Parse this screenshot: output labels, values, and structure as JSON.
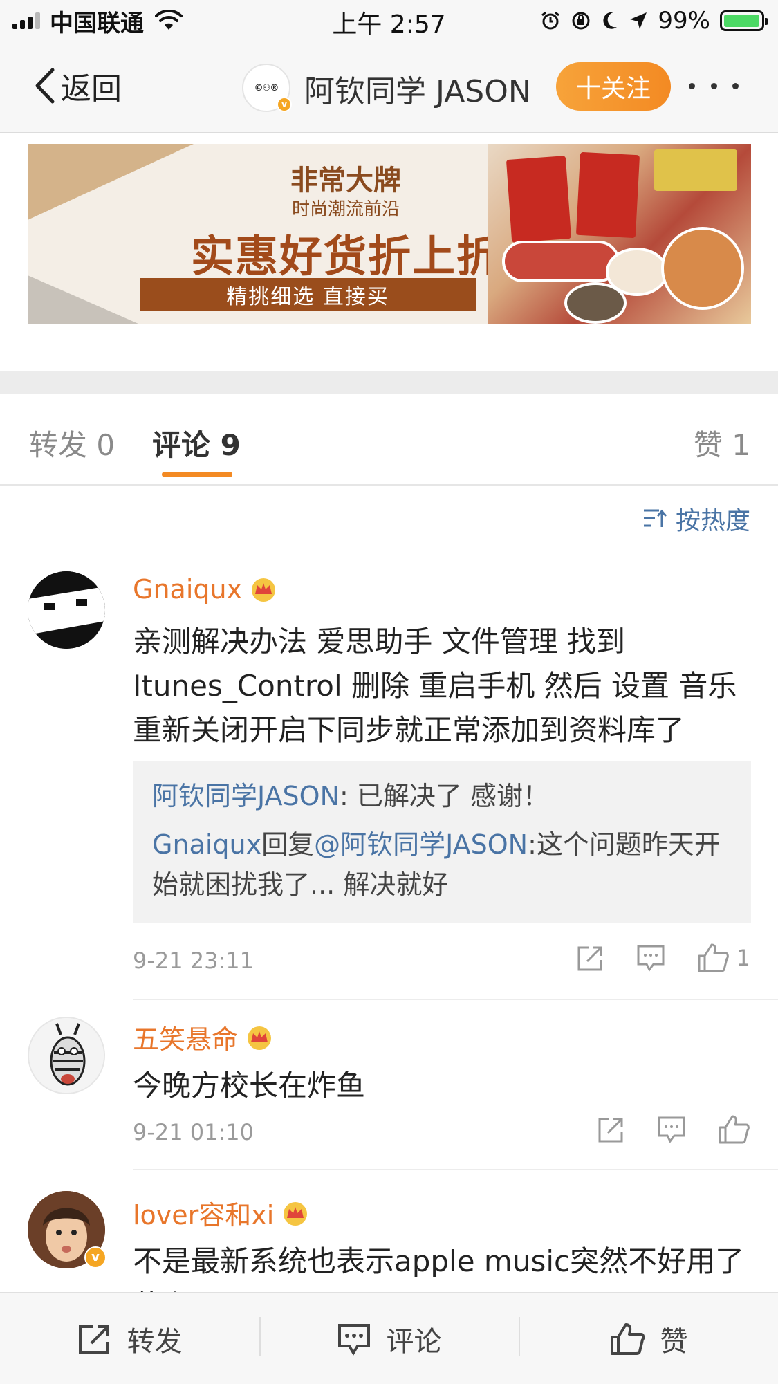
{
  "status_bar": {
    "carrier": "中国联通",
    "time": "上午 2:57",
    "battery_percent": "99%",
    "battery_level": 0.99
  },
  "nav": {
    "back_label": "返回",
    "title": "阿钦同学 JASON",
    "follow_label": "十关注"
  },
  "ad": {
    "headline": "非常大牌",
    "subheadline": "时尚潮流前沿",
    "main": "实惠好货折上折",
    "bar": "精挑细选 直接买"
  },
  "tabs": {
    "repost": "转发 0",
    "comment": "评论 9",
    "like": "赞 1"
  },
  "sort_label": "按热度",
  "comments": [
    {
      "username": "Gnaiqux",
      "text": "亲测解决办法 爱思助手 文件管理 找到 Itunes_Control 删除 重启手机 然后 设置 音乐 重新关闭开启下同步就正常添加到资料库了",
      "replies": [
        {
          "name": "阿钦同学JASON",
          "text": ": 已解决了 感谢！"
        },
        {
          "name": "Gnaiqux",
          "middle": "回复",
          "mention": "@阿钦同学JASON",
          "text": ":这个问题昨天开始就困扰我了... 解决就好"
        }
      ],
      "time": "9-21 23:11",
      "like_count": "1"
    },
    {
      "username": "五笑悬命",
      "text": "今晚方校长在炸鱼",
      "time": "9-21 01:10"
    },
    {
      "username": "lover容和xi",
      "text": "不是最新系统也表示apple music突然不好用了 什么原因？？？"
    }
  ],
  "bottom_bar": {
    "repost": "转发",
    "comment": "评论",
    "like": "赞"
  },
  "colors": {
    "accent_orange": "#f38a23",
    "username_orange": "#e8762b",
    "link_blue": "#4a74a5"
  }
}
